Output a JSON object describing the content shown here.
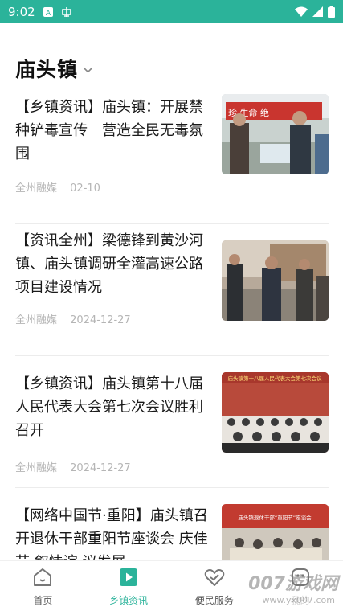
{
  "status_bar": {
    "time": "9:02"
  },
  "header": {
    "title": "庙头镇"
  },
  "articles": [
    {
      "title": "【乡镇资讯】庙头镇：开展禁种铲毒宣传　营造全民无毒氛围",
      "source": "全州融媒",
      "date": "02-10"
    },
    {
      "title": "【资讯全州】梁德锋到黄沙河镇、庙头镇调研全灌高速公路项目建设情况",
      "source": "全州融媒",
      "date": "2024-12-27"
    },
    {
      "title": "【乡镇资讯】庙头镇第十八届人民代表大会第七次会议胜利召开",
      "source": "全州融媒",
      "date": "2024-12-27"
    },
    {
      "title": "【网络中国节·重阳】庙头镇召开退休干部重阳节座谈会 庆佳节 叙情谊 议发展",
      "source": "",
      "date": ""
    }
  ],
  "thumb_texts": {
    "banner3": "庙头镇第十八届人民代表大会第七次会议",
    "banner4": "庙头镇退休干部“重阳节”座谈会"
  },
  "bottom_nav": [
    {
      "label": "首页"
    },
    {
      "label": "乡镇资讯"
    },
    {
      "label": "便民服务"
    },
    {
      "label": "我的"
    }
  ],
  "watermark": {
    "text": "007游戏网",
    "sub": "www.yx007.com"
  },
  "colors": {
    "accent": "#2bb39a"
  }
}
